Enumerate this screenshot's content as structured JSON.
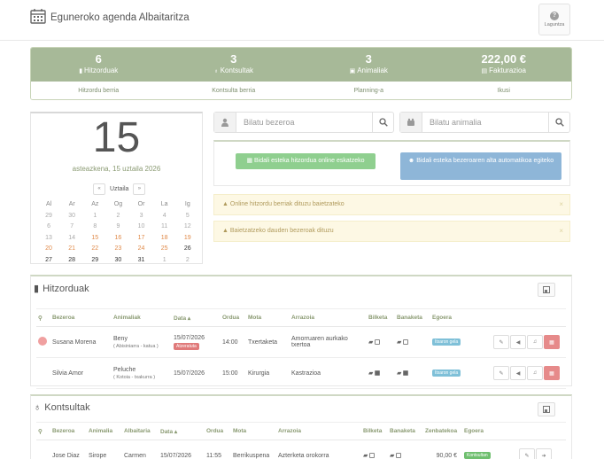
{
  "app": {
    "title": "Eguneroko agenda Albaitaritza",
    "help_label": "Laguntza"
  },
  "stats": [
    {
      "value": "6",
      "label": "Hitzorduak",
      "link": "Hitzordu berria"
    },
    {
      "value": "3",
      "label": "Kontsultak",
      "link": "Kontsulta berria"
    },
    {
      "value": "3",
      "label": "Animaliak",
      "link": "Planning-a"
    },
    {
      "value": "222,00 €",
      "label": "Fakturazioa",
      "link": "Ikusi"
    }
  ],
  "calendar": {
    "day": "15",
    "date_text": "asteazkena, 15 uztaila 2026",
    "month": "Uztaila",
    "prev": "«",
    "next": "»",
    "weekdays": [
      "Al",
      "Ar",
      "Az",
      "Og",
      "Or",
      "La",
      "Ig"
    ],
    "weeks": [
      [
        "29",
        "30",
        "1",
        "2",
        "3",
        "4",
        "5"
      ],
      [
        "6",
        "7",
        "8",
        "9",
        "10",
        "11",
        "12"
      ],
      [
        "13",
        "14",
        "15",
        "16",
        "17",
        "18",
        "19"
      ],
      [
        "20",
        "21",
        "22",
        "23",
        "24",
        "25",
        "26"
      ],
      [
        "27",
        "28",
        "29",
        "30",
        "31",
        "1",
        "2"
      ]
    ]
  },
  "search": {
    "client_placeholder": "Bilatu bezeroa",
    "animal_placeholder": "Bilatu animalia"
  },
  "links": {
    "online_appointment": "Bidali esteka hitzordua online eskatzeko",
    "client_registration": "Bidali esteka bezeroaren alta automatikoa egiteko"
  },
  "alerts": [
    {
      "text": "Online hitzordu berriak dituzu baietzateko",
      "close": "×"
    },
    {
      "text": "Baietzatzeko dauden bezeroak dituzu",
      "close": "×"
    }
  ],
  "appointments": {
    "title": "Hitzorduak",
    "columns": [
      "Bezeroa",
      "Animaliak",
      "Data ▴",
      "Ordua",
      "Mota",
      "Arrazoia",
      "Bilketa",
      "Banaketa",
      "Egoera"
    ],
    "rows": [
      {
        "client": "Susana Morena",
        "animal": "Beny",
        "animal_detail": "( Abisiniarra - katua )",
        "date": "15/07/2026",
        "late": "Atzeratuta",
        "time": "14:00",
        "type": "Txertaketa",
        "reason": "Amorruaren aurkako txertoa",
        "status": "Itxaron gela"
      },
      {
        "client": "Silvia Amor",
        "animal": "Peluche",
        "animal_detail": "( Kotoia - txakurra )",
        "date": "15/07/2026",
        "late": "",
        "time": "15:00",
        "type": "Kirurgia",
        "reason": "Kastrazioa",
        "status": "Itxaron gela"
      }
    ]
  },
  "consultations": {
    "title": "Kontsultak",
    "columns": [
      "Bezeroa",
      "Animalia",
      "Albaitaria",
      "Data ▴",
      "Ordua",
      "Mota",
      "Arrazoia",
      "Bilketa",
      "Banaketa",
      "Zenbatekoa",
      "Egoera"
    ],
    "rows": [
      {
        "client": "Jose Diaz",
        "animal": "Sirope",
        "vet": "Carmen",
        "date": "15/07/2026",
        "time": "11:55",
        "type": "Berrikuspena",
        "reason": "Azterketa orokorra",
        "amount": "90,00 €",
        "status": "Kontsultan"
      }
    ]
  },
  "colors": {
    "accent": "#a7b998",
    "green_button": "#8fcf8f",
    "blue_button": "#8eb6d8",
    "late_badge": "#e07a7a",
    "orange_weekend": "#e08a4a"
  }
}
